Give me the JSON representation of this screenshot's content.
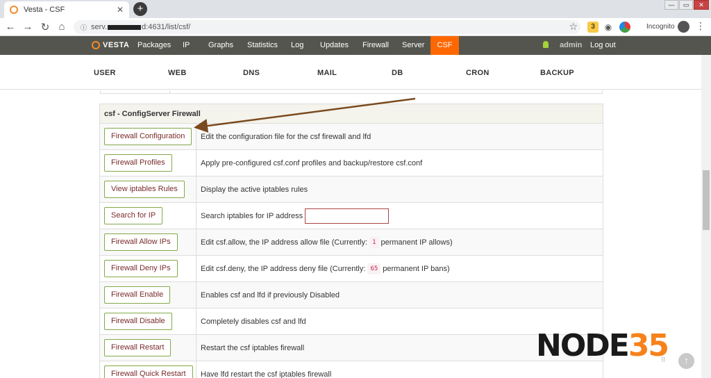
{
  "browser": {
    "tab_title": "Vesta - CSF",
    "tab_close": "✕",
    "newtab": "+",
    "url_prefix": "serv.",
    "url_suffix": "d:4631/list/csf/",
    "incognito": "Incognito",
    "ext_badge": "3",
    "winctl": {
      "min": "—",
      "max": "▭",
      "close": "✕"
    }
  },
  "topnav": {
    "logo": "VESTA",
    "items": [
      "Packages",
      "IP",
      "Graphs",
      "Statistics",
      "Log",
      "Updates",
      "Firewall",
      "Server",
      "CSF"
    ],
    "active": "CSF",
    "user": "admin",
    "logout": "Log out"
  },
  "sections": [
    "USER",
    "WEB",
    "DNS",
    "MAIL",
    "DB",
    "CRON",
    "BACKUP"
  ],
  "csf": {
    "header": "csf - ConfigServer Firewall",
    "rows": [
      {
        "button": "Firewall Configuration",
        "desc": "Edit the configuration file for the csf firewall and lfd"
      },
      {
        "button": "Firewall Profiles",
        "desc": "Apply pre-configured csf.conf profiles and backup/restore csf.conf"
      },
      {
        "button": "View iptables Rules",
        "desc": "Display the active iptables rules"
      },
      {
        "button": "Search for IP",
        "desc": "Search iptables for IP address"
      },
      {
        "button": "Firewall Allow IPs",
        "desc_before": "Edit csf.allow, the IP address allow file (Currently:",
        "count": "1",
        "desc_after": "permanent IP allows)"
      },
      {
        "button": "Firewall Deny IPs",
        "desc_before": "Edit csf.deny, the IP address deny file (Currently:",
        "count": "65",
        "desc_after": "permanent IP bans)"
      },
      {
        "button": "Firewall Enable",
        "desc": "Enables csf and lfd if previously Disabled"
      },
      {
        "button": "Firewall Disable",
        "desc": "Completely disables csf and lfd"
      },
      {
        "button": "Firewall Restart",
        "desc": "Restart the csf iptables firewall"
      },
      {
        "button": "Firewall Quick Restart",
        "desc": "Have lfd restart the csf iptables firewall"
      }
    ]
  },
  "watermark": {
    "part1": "NODE",
    "part2": "35"
  },
  "colors": {
    "accent": "#ff6701",
    "nav_bg": "#55554f",
    "button_border": "#83a84a",
    "button_text": "#7a2b2b",
    "arrow": "#7a4a1e"
  },
  "icons": {
    "back": "back-arrow-icon",
    "forward": "forward-arrow-icon",
    "reload": "reload-icon",
    "home": "home-icon",
    "star": "bookmark-star-icon",
    "bell": "bell-icon",
    "totop": "scroll-to-top-icon"
  }
}
